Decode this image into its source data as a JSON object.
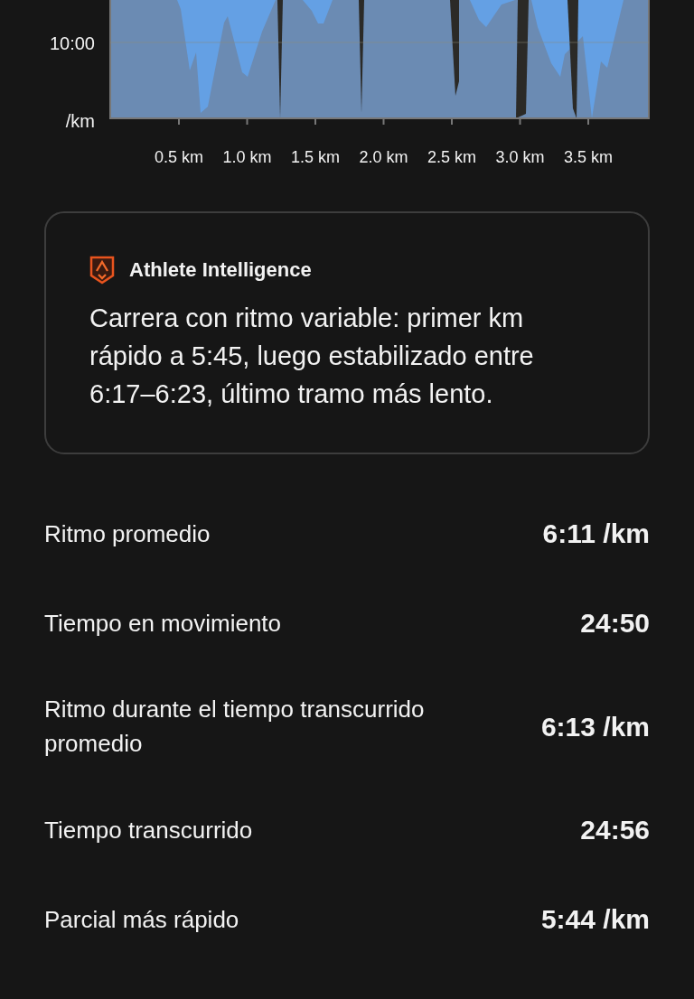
{
  "chart": {
    "y_labels": [
      "10:00",
      "/km"
    ],
    "x_labels": [
      "0.5 km",
      "1.0 km",
      "1.5 km",
      "2.0 km",
      "2.5 km",
      "3.0 km",
      "3.5 km"
    ]
  },
  "insight": {
    "title": "Athlete Intelligence",
    "text": "Carrera con ritmo variable: primer km rápido a 5:45, luego estabilizado entre 6:17–6:23, último tramo más lento."
  },
  "stats": [
    {
      "label": "Ritmo promedio",
      "value": "6:11 /km"
    },
    {
      "label": "Tiempo en movimiento",
      "value": "24:50"
    },
    {
      "label": "Ritmo durante el tiempo transcurrido promedio",
      "value": "6:13 /km"
    },
    {
      "label": "Tiempo transcurrido",
      "value": "24:56"
    },
    {
      "label": "Parcial más rápido",
      "value": "5:44 /km"
    }
  ]
}
